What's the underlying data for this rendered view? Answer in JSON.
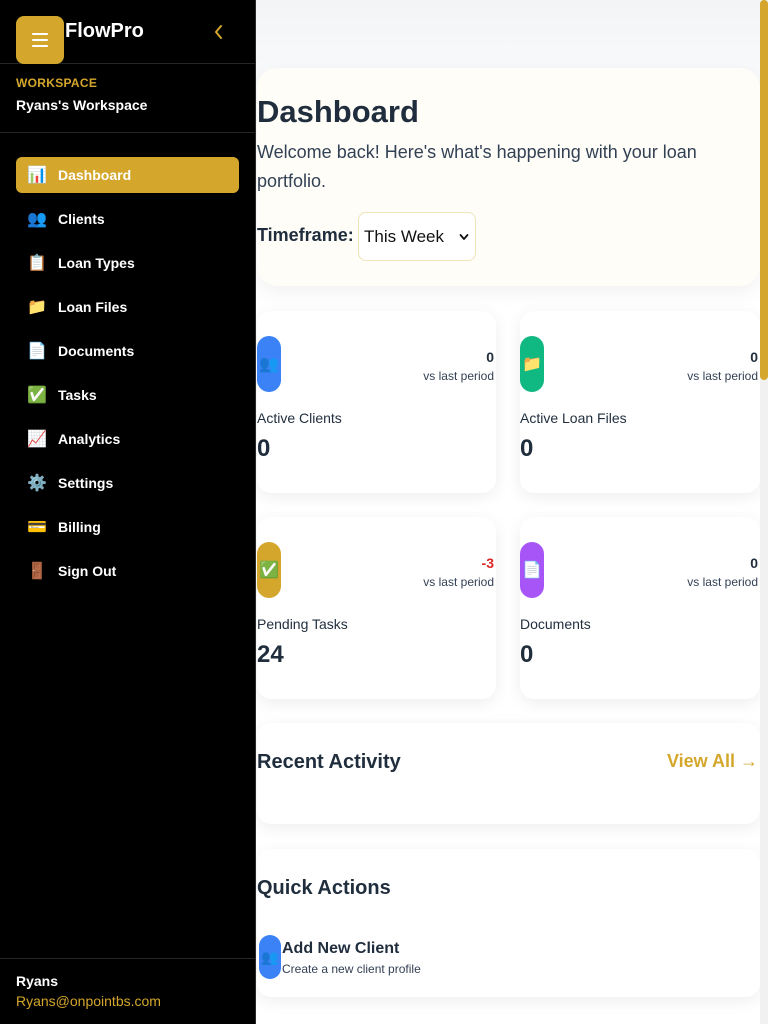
{
  "app": {
    "name": "FlowPro",
    "accent": "#d4a72c"
  },
  "workspace": {
    "label": "WORKSPACE",
    "name": "Ryans's Workspace"
  },
  "nav": [
    {
      "icon": "📊",
      "label": "Dashboard",
      "active": true
    },
    {
      "icon": "👥",
      "label": "Clients"
    },
    {
      "icon": "📋",
      "label": "Loan Types"
    },
    {
      "icon": "📁",
      "label": "Loan Files"
    },
    {
      "icon": "📄",
      "label": "Documents"
    },
    {
      "icon": "✅",
      "label": "Tasks"
    },
    {
      "icon": "📈",
      "label": "Analytics"
    },
    {
      "icon": "⚙️",
      "label": "Settings"
    },
    {
      "icon": "💳",
      "label": "Billing"
    },
    {
      "icon": "🚪",
      "label": "Sign Out"
    }
  ],
  "user": {
    "name": "Ryans",
    "email": "Ryans@onpointbs.com"
  },
  "dashboard": {
    "title": "Dashboard",
    "subtitle": "Welcome back! Here's what's happening with your loan portfolio.",
    "timeframe_label": "Timeframe:",
    "timeframe_value": "This Week"
  },
  "stats": [
    {
      "icon": "👥",
      "color": "#3b82f6",
      "change": "0",
      "vs": "vs last period",
      "label": "Active Clients",
      "value": "0"
    },
    {
      "icon": "📁",
      "color": "#10b981",
      "change": "0",
      "vs": "vs last period",
      "label": "Active Loan Files",
      "value": "0"
    },
    {
      "icon": "✅",
      "color": "#d4a72c",
      "change": "-3",
      "vs": "vs last period",
      "label": "Pending Tasks",
      "value": "24"
    },
    {
      "icon": "📄",
      "color": "#a855f7",
      "change": "0",
      "vs": "vs last period",
      "label": "Documents",
      "value": "0"
    }
  ],
  "recent_activity": {
    "title": "Recent Activity",
    "view_all": "View All →"
  },
  "quick_actions": {
    "title": "Quick Actions",
    "items": [
      {
        "icon": "👥",
        "title": "Add New Client",
        "subtitle": "Create a new client profile"
      }
    ]
  }
}
